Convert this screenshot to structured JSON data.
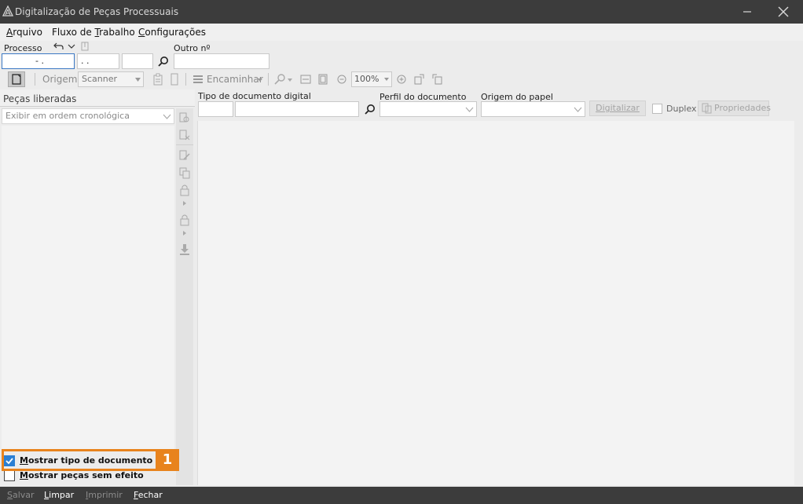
{
  "window": {
    "title": "Digitalização de Peças Processuais"
  },
  "menu": {
    "arquivo": {
      "ul": "A",
      "rest": "rquivo"
    },
    "fluxo": {
      "pre": "Fluxo de ",
      "ul": "T",
      "rest": "rabalho"
    },
    "config": {
      "ul": "C",
      "rest": "onfigurações"
    }
  },
  "search": {
    "processo_label": "Processo",
    "processo_value": "- .",
    "processo_part2": ". .",
    "processo_part3": "",
    "outro_label": "Outro nº",
    "outro_value": ""
  },
  "toolbar": {
    "origem_label": "Origem",
    "origem_value": "Scanner",
    "encaminhar_label": "Encaminhar",
    "zoom_value": "100%"
  },
  "left_panel": {
    "title": "Peças liberadas",
    "order_placeholder": "Exibir em ordem cronológica",
    "chk_saj": {
      "ul": "M",
      "rest": "ostrar tipo de documento SAJ",
      "checked": true
    },
    "chk_sem_efeito": {
      "ul": "M",
      "rest": "ostrar peças sem efeito",
      "checked": false
    },
    "callout_number": "1"
  },
  "doc_form": {
    "tipo_label": "Tipo de documento digital",
    "perfil_label": "Perfil do documento",
    "origem_papel_label": "Origem do papel",
    "digitalizar_label": "Digitalizar",
    "duplex_label": "Duplex",
    "propriedades_label": "Propriedades"
  },
  "statusbar": {
    "salvar": {
      "ul": "S",
      "rest": "alvar",
      "enabled": false
    },
    "limpar": {
      "ul": "L",
      "rest": "impar",
      "enabled": true
    },
    "imprimir": {
      "ul": "I",
      "rest": "mprimir",
      "enabled": false
    },
    "fechar": {
      "ul": "F",
      "rest": "echar",
      "enabled": true
    }
  },
  "colors": {
    "accent_orange": "#e8831d",
    "titlebar_bg": "#3c3c3c",
    "focus_blue": "#3b78c4",
    "checkbox_blue": "#2a7fd4"
  }
}
